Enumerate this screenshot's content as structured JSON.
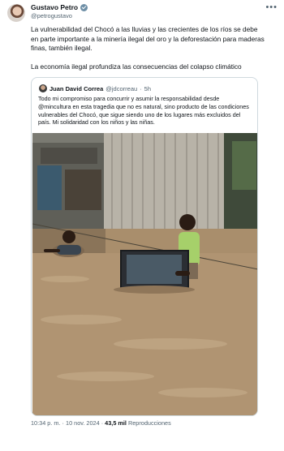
{
  "author": {
    "name": "Gustavo Petro",
    "handle": "@petrogustavo"
  },
  "tweet": {
    "paragraph1": "La vulnerabilidad del Chocó a las lluvias y las crecientes de los ríos se debe en parte importante a la minería ilegal del oro y la deforestación para maderas finas, también ilegal.",
    "paragraph2": "La economía ilegal profundiza las consecuencias del colapso climático"
  },
  "quoted": {
    "name": "Juan David Correa",
    "handle": "@jdcorreau",
    "separator": "·",
    "time": "5h",
    "text": "Todo mi compromiso para concurrir y asumir la responsabilidad desde @mincultura en esta tragedia que no es natural, sino producto de las condiciones vulnerables del Chocó, que sigue siendo uno de los lugares más excluidos del país. Mi solidaridad con los niños y las niñas."
  },
  "footer": {
    "time": "10:34 p. m.",
    "separator": "·",
    "date": "10 nov. 2024",
    "views_count": "43,5 mil",
    "views_label": "Reproducciones"
  },
  "icons": {
    "verified": "verified-badge-icon",
    "more": "more-horizontal-icon"
  },
  "colors": {
    "verified_badge": "#6e8fa6",
    "secondary_text": "#536471",
    "border": "#cfd9de"
  }
}
